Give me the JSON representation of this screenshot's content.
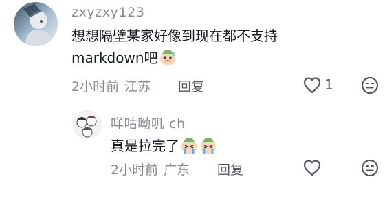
{
  "comment": {
    "username": "zxyzxy123",
    "text_line1": "想想隔壁某家好像到现在都不支持",
    "text_line2": "markdown吧",
    "emoji": "sweat-face-emoji",
    "time": "2小时前",
    "location": "江苏",
    "reply_label": "回复",
    "like_count": "1"
  },
  "reply": {
    "username": "咩咕呦叽 ch",
    "text": "真是拉完了",
    "emoji": "crying-face-emoji",
    "time": "2小时前",
    "location": "广东",
    "reply_label": "回复"
  },
  "colors": {
    "meta_gray": "#8a8b91",
    "text": "#161823",
    "icon": "#555661"
  }
}
